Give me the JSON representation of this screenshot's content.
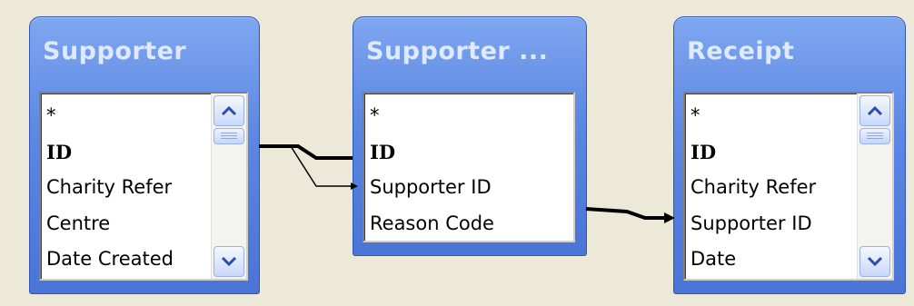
{
  "tables": [
    {
      "title": "Supporter",
      "fields": [
        "*",
        "ID",
        "Charity Refer",
        "Centre",
        "Date Created"
      ],
      "scrollbar": true
    },
    {
      "title": "Supporter ...",
      "fields": [
        "*",
        "ID",
        "Supporter ID",
        "Reason Code"
      ],
      "scrollbar": false
    },
    {
      "title": "Receipt",
      "fields": [
        "*",
        "ID",
        "Charity Refer",
        "Supporter ID",
        "Date"
      ],
      "scrollbar": true
    }
  ],
  "icons": {
    "scroll_up": "chevron-up-icon",
    "scroll_down": "chevron-down-icon"
  },
  "colors": {
    "background": "#ece9d8",
    "title_bar": "#5b86e2",
    "title_text": "#dfe9ff",
    "relationship_line": "#000000"
  }
}
